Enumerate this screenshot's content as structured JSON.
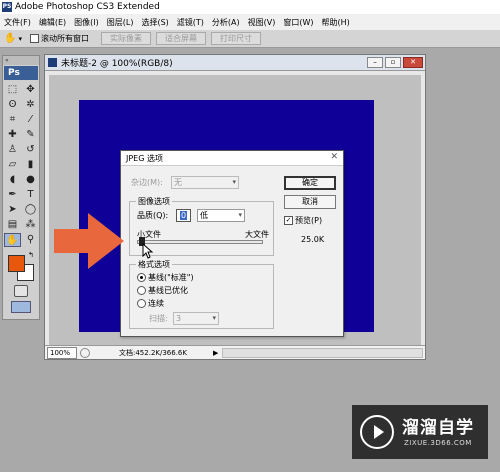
{
  "app": {
    "title": "Adobe Photoshop CS3 Extended",
    "logo": "Ps",
    "logo_small": "PS"
  },
  "menu": [
    "文件(F)",
    "编辑(E)",
    "图像(I)",
    "图层(L)",
    "选择(S)",
    "滤镜(T)",
    "分析(A)",
    "视图(V)",
    "窗口(W)",
    "帮助(H)"
  ],
  "options": {
    "tool_icon": "hand-icon",
    "scroll_all_label": "滚动所有窗口",
    "actual_pixels": "实际像素",
    "fit_screen": "适合屏幕",
    "print_size": "打印尺寸"
  },
  "toolbox": {
    "tools": [
      {
        "name": "marquee-tool",
        "glyph": "⬚"
      },
      {
        "name": "move-tool",
        "glyph": "✥"
      },
      {
        "name": "lasso-tool",
        "glyph": "ʘ"
      },
      {
        "name": "magic-wand-tool",
        "glyph": "✲"
      },
      {
        "name": "crop-tool",
        "glyph": "⌗"
      },
      {
        "name": "slice-tool",
        "glyph": "⁄"
      },
      {
        "name": "healing-brush-tool",
        "glyph": "✚"
      },
      {
        "name": "brush-tool",
        "glyph": "✎"
      },
      {
        "name": "clone-stamp-tool",
        "glyph": "♙"
      },
      {
        "name": "history-brush-tool",
        "glyph": "↺"
      },
      {
        "name": "eraser-tool",
        "glyph": "▱"
      },
      {
        "name": "gradient-tool",
        "glyph": "▮"
      },
      {
        "name": "blur-tool",
        "glyph": "◖"
      },
      {
        "name": "dodge-tool",
        "glyph": "●"
      },
      {
        "name": "pen-tool",
        "glyph": "✒"
      },
      {
        "name": "type-tool",
        "glyph": "T"
      },
      {
        "name": "path-selection-tool",
        "glyph": "➤"
      },
      {
        "name": "shape-tool",
        "glyph": "◯"
      },
      {
        "name": "notes-tool",
        "glyph": "▤"
      },
      {
        "name": "eyedropper-tool",
        "glyph": "⁂"
      },
      {
        "name": "hand-tool",
        "glyph": "✋"
      },
      {
        "name": "zoom-tool",
        "glyph": "⚲"
      }
    ],
    "foreground_color": "#e8580c",
    "background_color": "#ffffff"
  },
  "document": {
    "title": "未标题-2 @ 100%(RGB/8)",
    "canvas_color": "#0f0097",
    "zoom": "100%",
    "doc_size": "文档:452.2K/366.6K"
  },
  "jpeg_dialog": {
    "title": "JPEG 选项",
    "matte_label": "杂边(M):",
    "matte_value": "无",
    "image_options_label": "图像选项",
    "quality_label": "品质(Q):",
    "quality_value": "0",
    "quality_preset": "低",
    "small_file": "小文件",
    "large_file": "大文件",
    "format_options_label": "格式选项",
    "baseline_standard": "基线(\"标准\")",
    "baseline_optimized": "基线已优化",
    "progressive": "连续",
    "scans_label": "扫描:",
    "scans_value": "3",
    "ok": "确定",
    "cancel": "取消",
    "preview_label": "预览(P)",
    "file_size": "25.0K"
  },
  "annotation": {
    "arrow_color": "#e8673c"
  },
  "watermark": {
    "title": "溜溜自学",
    "subtitle": "ZIXUE.3D66.COM"
  }
}
